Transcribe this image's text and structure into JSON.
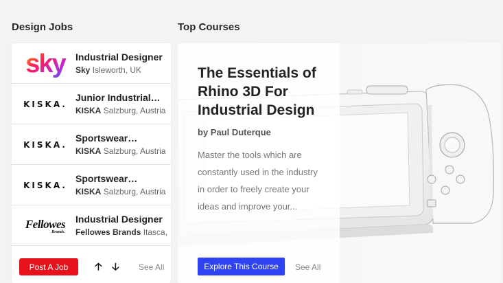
{
  "jobs_section": {
    "title": "Design Jobs",
    "items": [
      {
        "logo": "Sky",
        "title": "Industrial Designer",
        "company": "Sky",
        "location": "Isleworth, UK"
      },
      {
        "logo": "KISKA.",
        "title": "Junior Industrial Designer",
        "company": "KISKA",
        "location": "Salzburg, Austria"
      },
      {
        "logo": "KISKA.",
        "title": "Sportswear Designer",
        "company": "KISKA",
        "location": "Salzburg, Austria"
      },
      {
        "logo": "KISKA.",
        "title": "Sportswear Designer",
        "company": "KISKA",
        "location": "Salzburg, Austria"
      },
      {
        "logo": "Fellowes",
        "logo_sub": "Brands.",
        "title": "Industrial Designer",
        "company": "Fellowes Brands",
        "location": "Itasca, IL"
      }
    ],
    "post_button": "Post A Job",
    "up_arrow": "🡡",
    "down_arrow": "🡣",
    "see_all": "See All"
  },
  "courses_section": {
    "title": "Top Courses",
    "course": {
      "title": "The Essentials of Rhino 3D For Industrial Design",
      "author": "by Paul Duterque",
      "description": "Master the tools which are constantly used in the industry in order to freely create your ideas and improve your rendering quality. Cleaner...",
      "explore_button": "Explore This Course",
      "see_all": "See All"
    }
  },
  "colors": {
    "post_button": "#e8121c",
    "explore_button": "#2f43f2",
    "background": "#f3f3f3"
  }
}
